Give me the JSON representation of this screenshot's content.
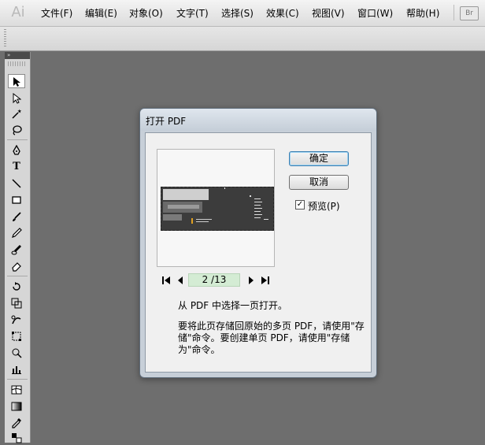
{
  "app": {
    "logo_text": "Ai",
    "bridge_label": "Br"
  },
  "menu": [
    {
      "label": "文件(F)"
    },
    {
      "label": "编辑(E)"
    },
    {
      "label": "对象(O)"
    },
    {
      "label": "文字(T)"
    },
    {
      "label": "选择(S)"
    },
    {
      "label": "效果(C)"
    },
    {
      "label": "视图(V)"
    },
    {
      "label": "窗口(W)"
    },
    {
      "label": "帮助(H)"
    }
  ],
  "toolbox": {
    "header_glyph": "»",
    "tools": [
      {
        "name": "selection-tool-icon",
        "selected": true
      },
      {
        "name": "direct-selection-tool-icon"
      },
      {
        "name": "magic-wand-tool-icon"
      },
      {
        "name": "lasso-tool-icon"
      },
      {
        "name": "pen-tool-icon"
      },
      {
        "name": "type-tool-icon"
      },
      {
        "name": "line-segment-tool-icon"
      },
      {
        "name": "rectangle-tool-icon"
      },
      {
        "name": "paintbrush-tool-icon"
      },
      {
        "name": "pencil-tool-icon"
      },
      {
        "name": "blob-brush-tool-icon"
      },
      {
        "name": "eraser-tool-icon"
      },
      {
        "name": "rotate-tool-icon"
      },
      {
        "name": "scale-tool-icon"
      },
      {
        "name": "warp-tool-icon"
      },
      {
        "name": "free-transform-tool-icon"
      },
      {
        "name": "shape-builder-tool-icon"
      },
      {
        "name": "graph-tool-icon"
      },
      {
        "name": "mesh-tool-icon"
      },
      {
        "name": "gradient-tool-icon"
      },
      {
        "name": "eyedropper-tool-icon"
      },
      {
        "name": "blend-tool-icon"
      }
    ]
  },
  "dialog": {
    "title": "打开 PDF",
    "ok_label": "确定",
    "cancel_label": "取消",
    "preview_label": "预览(P)",
    "preview_checked": true,
    "page_indicator": "2 /13",
    "info_line1": "从 PDF 中选择一页打开。",
    "info_line2": "要将此页存储回原始的多页 PDF，请使用\"存储\"命令。要创建单页 PDF，请使用\"存储为\"命令。",
    "check_mark": "✓"
  },
  "colors": {
    "workspace": "#6e6e6e",
    "page_field_bg": "#d4ecd4",
    "default_button_border": "#3c7fb1"
  }
}
